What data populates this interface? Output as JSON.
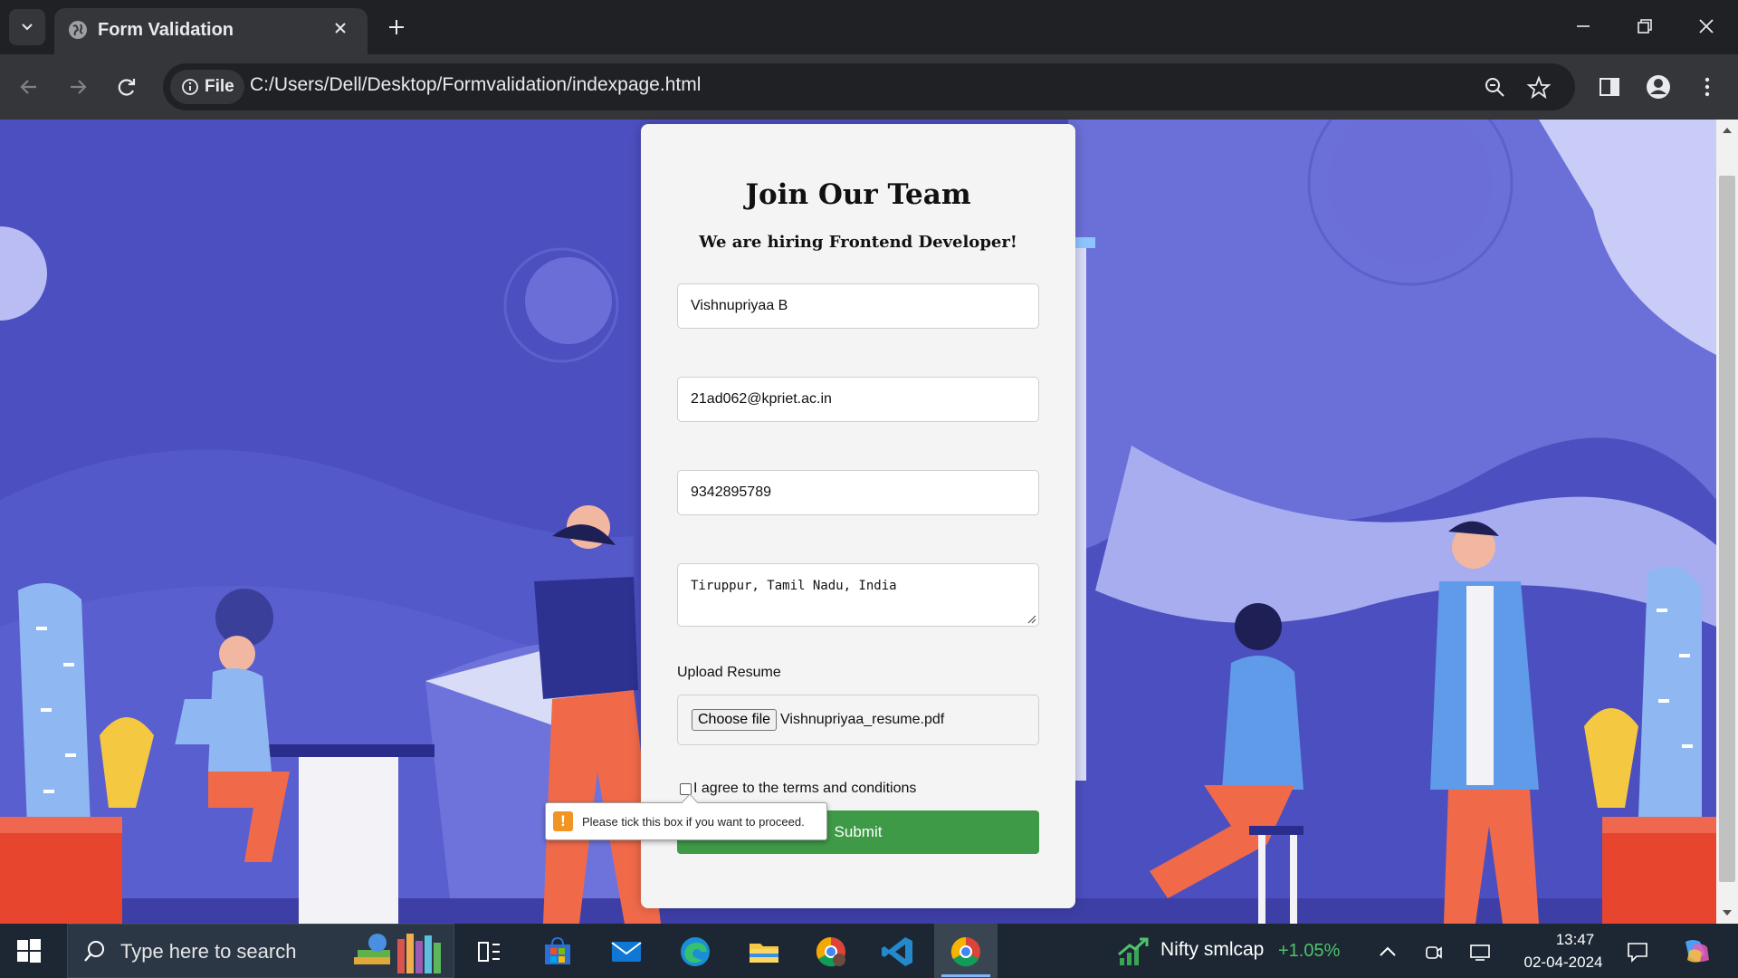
{
  "browser": {
    "tab_title": "Form Validation",
    "chip_label": "File",
    "url": "C:/Users/Dell/Desktop/Formvalidation/indexpage.html"
  },
  "form": {
    "heading": "Join Our Team",
    "subheading": "We are hiring Frontend Developer!",
    "name_value": "Vishnupriyaa B",
    "email_value": "21ad062@kpriet.ac.in",
    "phone_value": "9342895789",
    "address_value": "Tiruppur, Tamil Nadu, India",
    "upload_label": "Upload Resume",
    "choose_file_label": "Choose file",
    "file_name": "Vishnupriyaa_resume.pdf",
    "terms_label": "I agree to the terms and conditions",
    "terms_checked": false,
    "submit_label": "Submit",
    "validation_message": "Please tick this box if you want to proceed."
  },
  "taskbar": {
    "search_placeholder": "Type here to search",
    "ticker_name": "Nifty smlcap",
    "ticker_change": "+1.05%",
    "time": "13:47",
    "date": "02-04-2024"
  },
  "colors": {
    "background": "#4c4fbf",
    "submit": "#3f9a47",
    "ticker_positive": "#4fc36b",
    "warning": "#f29423"
  }
}
